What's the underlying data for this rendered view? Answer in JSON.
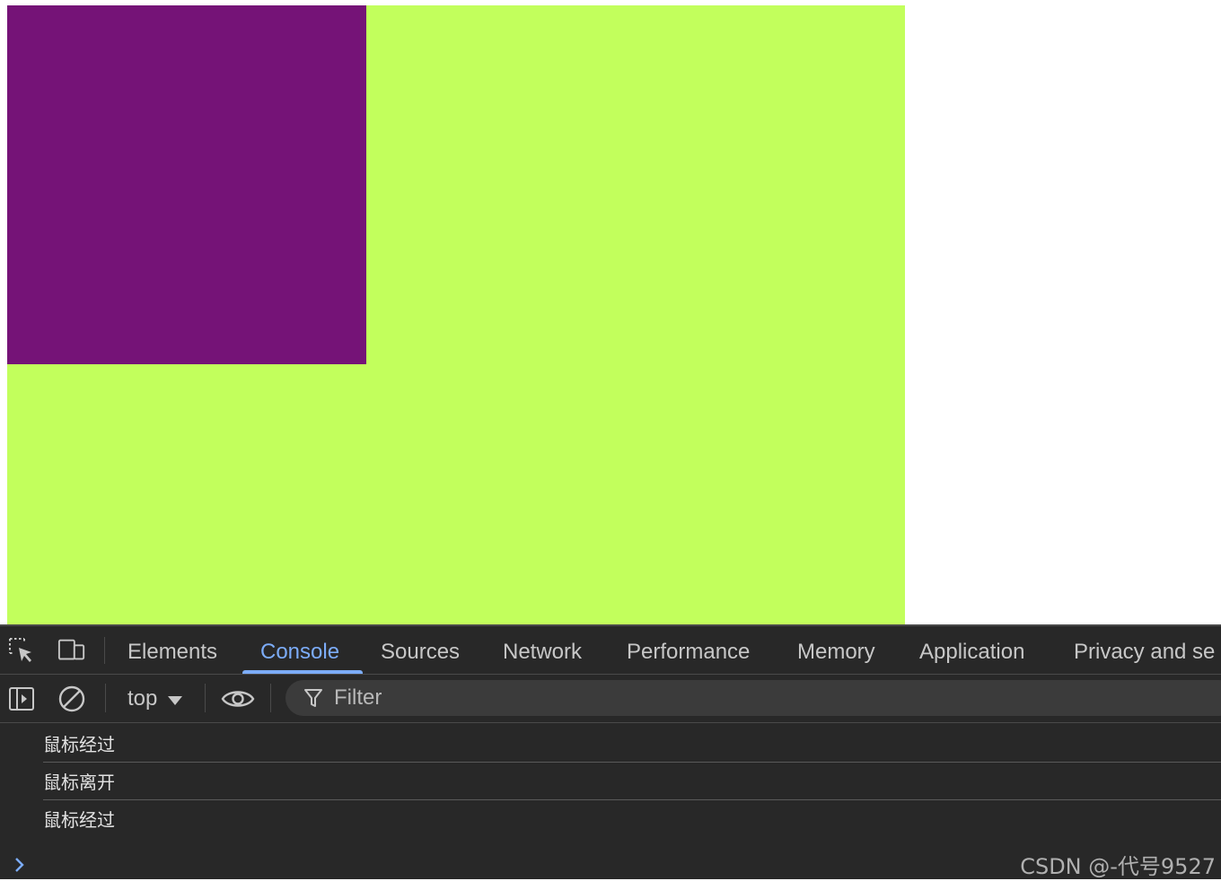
{
  "page": {
    "outer_box_color": "#c2ff5c",
    "inner_box_color": "#751377"
  },
  "devtools": {
    "tabs": [
      {
        "label": "Elements",
        "active": false
      },
      {
        "label": "Console",
        "active": true
      },
      {
        "label": "Sources",
        "active": false
      },
      {
        "label": "Network",
        "active": false
      },
      {
        "label": "Performance",
        "active": false
      },
      {
        "label": "Memory",
        "active": false
      },
      {
        "label": "Application",
        "active": false
      },
      {
        "label": "Privacy and se",
        "active": false
      }
    ],
    "icons": {
      "inspect": "inspect-element-icon",
      "device": "device-toolbar-icon",
      "sidebar": "sidebar-toggle-icon",
      "clear": "clear-console-icon",
      "eye": "live-expression-eye-icon",
      "filter": "filter-icon",
      "prompt": "chevron-right-icon"
    },
    "accent_color": "#7cacf8",
    "console": {
      "context": "top",
      "filter_placeholder": "Filter",
      "logs": [
        "鼠标经过",
        "鼠标离开",
        "鼠标经过"
      ]
    }
  },
  "watermark": "CSDN @-代号9527"
}
